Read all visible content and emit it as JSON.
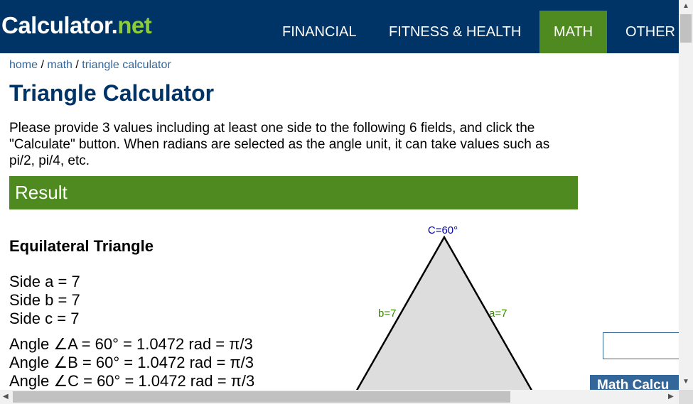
{
  "header": {
    "logo_main": "Calculator",
    "logo_dot": ".",
    "logo_tld": "net",
    "nav": [
      "FINANCIAL",
      "FITNESS & HEALTH",
      "MATH",
      "OTHER"
    ],
    "active_nav": "MATH"
  },
  "breadcrumb": {
    "home": "home",
    "sep": " / ",
    "math": "math",
    "current": "triangle calculator"
  },
  "page_title": "Triangle Calculator",
  "intro": "Please provide 3 values including at least one side to the following 6 fields, and click the \"Calculate\" button. When radians are selected as the angle unit, it can take values such as pi/2, pi/4, etc.",
  "result": {
    "heading": "Result",
    "triangle_type": "Equilateral Triangle",
    "sides": [
      "Side a = 7",
      "Side b = 7",
      "Side c = 7"
    ],
    "angles": [
      "Angle ∠A = 60° = 1.0472 rad = π/3",
      "Angle ∠B = 60° = 1.0472 rad = π/3",
      "Angle ∠C = 60° = 1.0472 rad = π/3"
    ]
  },
  "diagram": {
    "label_c": "C=60°",
    "label_b": "b=7",
    "label_a": "a=7",
    "fill_color": "#dddddd",
    "label_c_color": "#0000aa",
    "label_side_color": "#338800"
  },
  "sidebar": {
    "box_title": "Math Calcu"
  },
  "colors": {
    "header": "#003366",
    "accent": "#4e8a1f",
    "link": "#336699"
  }
}
